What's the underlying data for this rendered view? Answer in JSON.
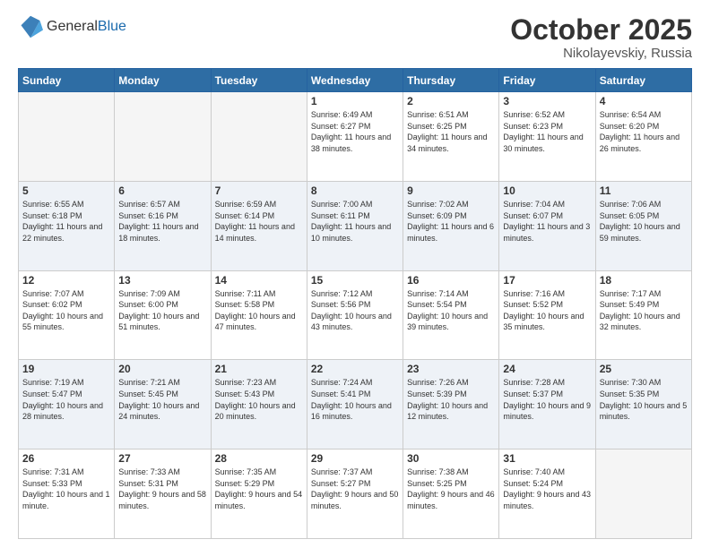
{
  "header": {
    "logo_general": "General",
    "logo_blue": "Blue",
    "month_title": "October 2025",
    "subtitle": "Nikolayevskiy, Russia"
  },
  "weekdays": [
    "Sunday",
    "Monday",
    "Tuesday",
    "Wednesday",
    "Thursday",
    "Friday",
    "Saturday"
  ],
  "weeks": [
    [
      {
        "day": "",
        "empty": true
      },
      {
        "day": "",
        "empty": true
      },
      {
        "day": "",
        "empty": true
      },
      {
        "day": "1",
        "sunrise": "6:49 AM",
        "sunset": "6:27 PM",
        "daylight": "11 hours and 38 minutes."
      },
      {
        "day": "2",
        "sunrise": "6:51 AM",
        "sunset": "6:25 PM",
        "daylight": "11 hours and 34 minutes."
      },
      {
        "day": "3",
        "sunrise": "6:52 AM",
        "sunset": "6:23 PM",
        "daylight": "11 hours and 30 minutes."
      },
      {
        "day": "4",
        "sunrise": "6:54 AM",
        "sunset": "6:20 PM",
        "daylight": "11 hours and 26 minutes."
      }
    ],
    [
      {
        "day": "5",
        "sunrise": "6:55 AM",
        "sunset": "6:18 PM",
        "daylight": "11 hours and 22 minutes."
      },
      {
        "day": "6",
        "sunrise": "6:57 AM",
        "sunset": "6:16 PM",
        "daylight": "11 hours and 18 minutes."
      },
      {
        "day": "7",
        "sunrise": "6:59 AM",
        "sunset": "6:14 PM",
        "daylight": "11 hours and 14 minutes."
      },
      {
        "day": "8",
        "sunrise": "7:00 AM",
        "sunset": "6:11 PM",
        "daylight": "11 hours and 10 minutes."
      },
      {
        "day": "9",
        "sunrise": "7:02 AM",
        "sunset": "6:09 PM",
        "daylight": "11 hours and 6 minutes."
      },
      {
        "day": "10",
        "sunrise": "7:04 AM",
        "sunset": "6:07 PM",
        "daylight": "11 hours and 3 minutes."
      },
      {
        "day": "11",
        "sunrise": "7:06 AM",
        "sunset": "6:05 PM",
        "daylight": "10 hours and 59 minutes."
      }
    ],
    [
      {
        "day": "12",
        "sunrise": "7:07 AM",
        "sunset": "6:02 PM",
        "daylight": "10 hours and 55 minutes."
      },
      {
        "day": "13",
        "sunrise": "7:09 AM",
        "sunset": "6:00 PM",
        "daylight": "10 hours and 51 minutes."
      },
      {
        "day": "14",
        "sunrise": "7:11 AM",
        "sunset": "5:58 PM",
        "daylight": "10 hours and 47 minutes."
      },
      {
        "day": "15",
        "sunrise": "7:12 AM",
        "sunset": "5:56 PM",
        "daylight": "10 hours and 43 minutes."
      },
      {
        "day": "16",
        "sunrise": "7:14 AM",
        "sunset": "5:54 PM",
        "daylight": "10 hours and 39 minutes."
      },
      {
        "day": "17",
        "sunrise": "7:16 AM",
        "sunset": "5:52 PM",
        "daylight": "10 hours and 35 minutes."
      },
      {
        "day": "18",
        "sunrise": "7:17 AM",
        "sunset": "5:49 PM",
        "daylight": "10 hours and 32 minutes."
      }
    ],
    [
      {
        "day": "19",
        "sunrise": "7:19 AM",
        "sunset": "5:47 PM",
        "daylight": "10 hours and 28 minutes."
      },
      {
        "day": "20",
        "sunrise": "7:21 AM",
        "sunset": "5:45 PM",
        "daylight": "10 hours and 24 minutes."
      },
      {
        "day": "21",
        "sunrise": "7:23 AM",
        "sunset": "5:43 PM",
        "daylight": "10 hours and 20 minutes."
      },
      {
        "day": "22",
        "sunrise": "7:24 AM",
        "sunset": "5:41 PM",
        "daylight": "10 hours and 16 minutes."
      },
      {
        "day": "23",
        "sunrise": "7:26 AM",
        "sunset": "5:39 PM",
        "daylight": "10 hours and 12 minutes."
      },
      {
        "day": "24",
        "sunrise": "7:28 AM",
        "sunset": "5:37 PM",
        "daylight": "10 hours and 9 minutes."
      },
      {
        "day": "25",
        "sunrise": "7:30 AM",
        "sunset": "5:35 PM",
        "daylight": "10 hours and 5 minutes."
      }
    ],
    [
      {
        "day": "26",
        "sunrise": "7:31 AM",
        "sunset": "5:33 PM",
        "daylight": "10 hours and 1 minute."
      },
      {
        "day": "27",
        "sunrise": "7:33 AM",
        "sunset": "5:31 PM",
        "daylight": "9 hours and 58 minutes."
      },
      {
        "day": "28",
        "sunrise": "7:35 AM",
        "sunset": "5:29 PM",
        "daylight": "9 hours and 54 minutes."
      },
      {
        "day": "29",
        "sunrise": "7:37 AM",
        "sunset": "5:27 PM",
        "daylight": "9 hours and 50 minutes."
      },
      {
        "day": "30",
        "sunrise": "7:38 AM",
        "sunset": "5:25 PM",
        "daylight": "9 hours and 46 minutes."
      },
      {
        "day": "31",
        "sunrise": "7:40 AM",
        "sunset": "5:24 PM",
        "daylight": "9 hours and 43 minutes."
      },
      {
        "day": "",
        "empty": true
      }
    ]
  ],
  "labels": {
    "sunrise": "Sunrise:",
    "sunset": "Sunset:",
    "daylight": "Daylight:"
  }
}
